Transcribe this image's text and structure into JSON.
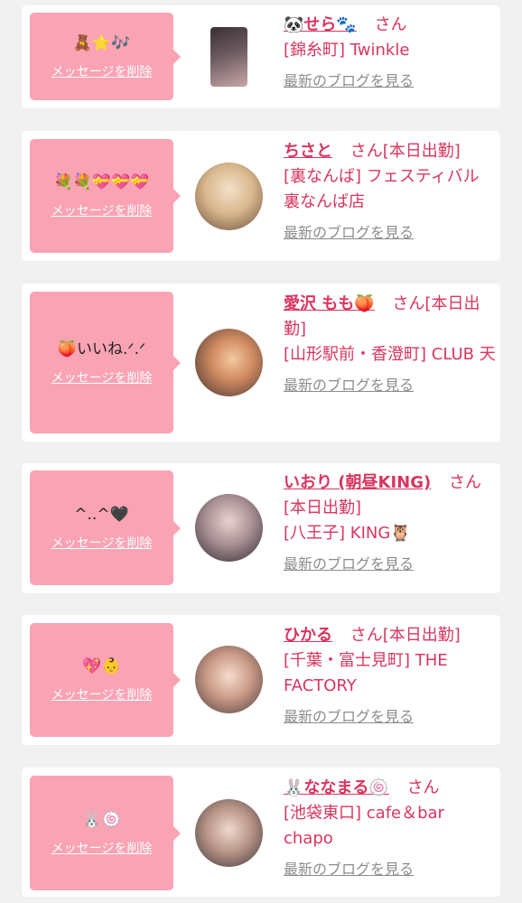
{
  "delete_label": "メッセージを削除",
  "blog_label": "最新のブログを見る",
  "honorific": "さん",
  "colors": {
    "bubble": "#f9a3b4",
    "accent": "#d9355f",
    "muted": "#8c8c8c",
    "page_bg": "#f1f1f1"
  },
  "messages": [
    {
      "text": "🧸⭐🎶",
      "name": "🐼せら🐾",
      "status": "",
      "shop": "[錦糸町] Twinkle",
      "avatar_icon": "girl-photo-icon"
    },
    {
      "text": "💐💐💝💝💝",
      "name": "ちさと",
      "status": "[本日出勤]",
      "shop": "[裏なんば] フェスティバル 裏なんば店",
      "avatar_icon": "girl-photo-icon"
    },
    {
      "text": "🍑いいね.ᐟ.ᐟ",
      "name": "愛沢 もも🍑",
      "status": "[本日出勤]",
      "shop": "[山形駅前・香澄町] CLUB 天",
      "avatar_icon": "girl-photo-icon"
    },
    {
      "text": "^..^🖤",
      "name": "いおり (朝昼KING)",
      "status": "[本日出勤]",
      "shop": "[八王子] KING🦉",
      "avatar_icon": "girl-photo-icon"
    },
    {
      "text": "💖👶",
      "name": "ひかる",
      "status": "[本日出勤]",
      "shop": "[千葉・富士見町] THE FACTORY",
      "avatar_icon": "girl-photo-icon"
    },
    {
      "text": "🐰🍥",
      "name": "🐰ななまる🍥",
      "status": "",
      "shop": "[池袋東口] cafe＆bar chapo",
      "avatar_icon": "girl-photo-icon"
    }
  ]
}
